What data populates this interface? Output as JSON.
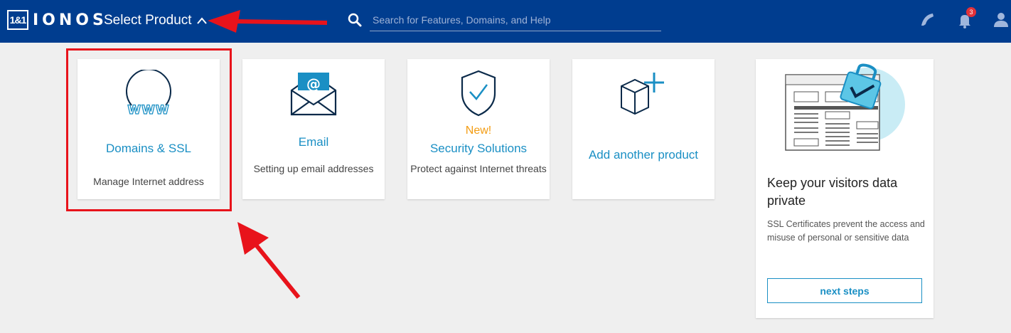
{
  "header": {
    "logo_mark": "1&1",
    "logo_text": "IONOS",
    "select_product_label": "Select Product",
    "search_placeholder": "Search for Features, Domains, and Help",
    "notification_count": "3"
  },
  "products": [
    {
      "title": "Domains & SSL",
      "description": "Manage Internet address",
      "icon": "globe-www-icon"
    },
    {
      "title": "Email",
      "description": "Setting up email addresses",
      "icon": "envelope-at-icon"
    },
    {
      "badge": "New!",
      "title": "Security Solutions",
      "description": "Protect against Internet threats",
      "icon": "shield-check-icon"
    },
    {
      "title": "Add another product",
      "icon": "box-plus-icon"
    }
  ],
  "promo": {
    "title": "Keep your visitors data private",
    "text": "SSL Certificates prevent the access and misuse of personal or sensitive data",
    "button": "next steps",
    "illustration": "ssl-lock-webpage-illustration"
  },
  "colors": {
    "header_bg": "#003d8f",
    "accent": "#1a8fc4",
    "new_badge": "#f39c12",
    "annotation": "#e8131b"
  }
}
